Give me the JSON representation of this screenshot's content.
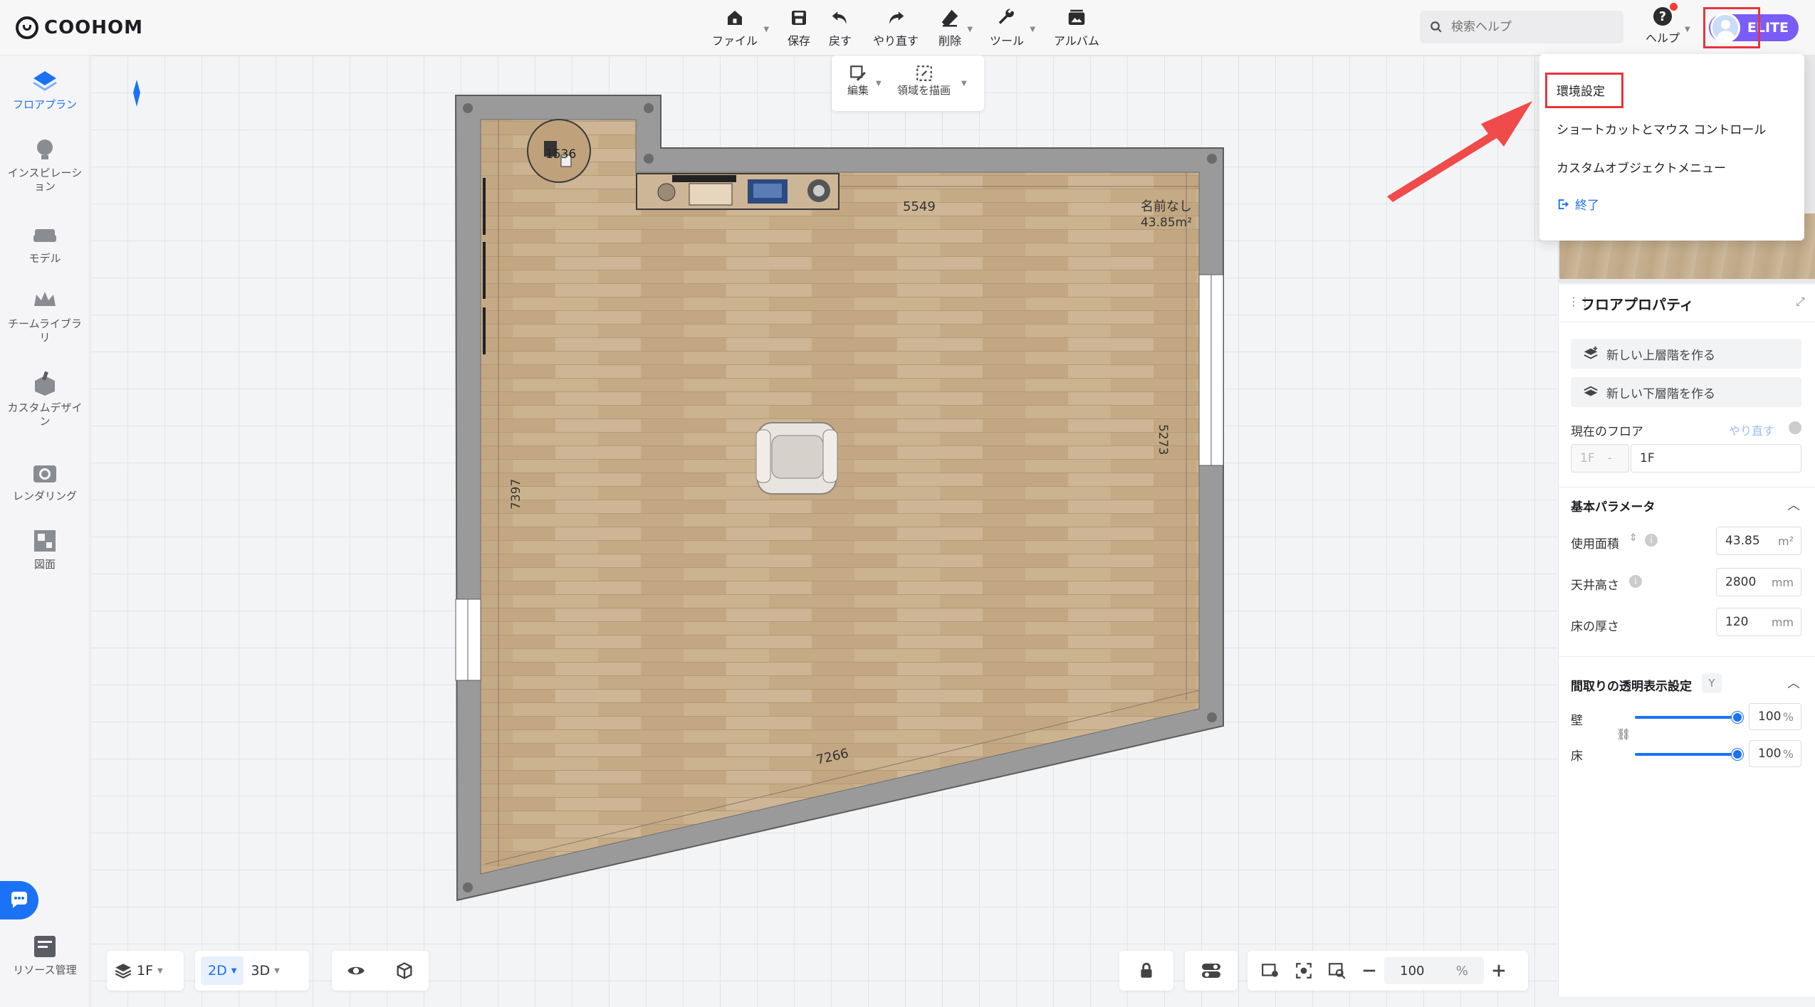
{
  "app": {
    "logo_text": "COOHOM"
  },
  "toolbar": {
    "file": "ファイル",
    "save": "保存",
    "undo": "戻す",
    "redo": "やり直す",
    "delete": "削除",
    "tools": "ツール",
    "album": "アルバム"
  },
  "subtoolbar": {
    "edit": "編集",
    "draw_region": "領域を描画"
  },
  "search": {
    "placeholder": "検索ヘルプ"
  },
  "help": {
    "label": "ヘルプ",
    "icon": "?"
  },
  "user": {
    "badge": "ELITE"
  },
  "user_menu": {
    "items": [
      "環境設定",
      "ショートカットとマウス コントロール",
      "カスタムオブジェクトメニュー"
    ],
    "exit": "終了"
  },
  "sidebar": {
    "items": [
      {
        "label": "フロアプラン",
        "icon": "floorplan-icon",
        "active": true
      },
      {
        "label": "インスピレーション",
        "icon": "lightbulb-icon"
      },
      {
        "label": "モデル",
        "icon": "sofa-icon"
      },
      {
        "label": "チームライブラリ",
        "icon": "crown-icon"
      },
      {
        "label": "カスタムデザイン",
        "icon": "custom-design-icon"
      },
      {
        "label": "レンダリング",
        "icon": "camera-icon"
      },
      {
        "label": "図面",
        "icon": "blueprint-icon"
      }
    ],
    "resource": "リソース管理"
  },
  "floorplan": {
    "room_name": "名前なし",
    "room_area": "43.85m²",
    "dimensions": {
      "top": "5549",
      "right": "5273",
      "left": "7397",
      "bottom": "7266",
      "round": "1536"
    }
  },
  "bottom_toolbar": {
    "floor": "1F",
    "view_2d": "2D",
    "view_3d": "3D",
    "zoom_value": "100",
    "zoom_unit": "%"
  },
  "panel": {
    "title": "フロアプロパティ",
    "new_upper": "新しい上層階を作る",
    "new_lower": "新しい下層階を作る",
    "current_floor_label": "現在のフロア",
    "redo_link": "やり直す",
    "floor_prefix": "1F",
    "floor_name": "1F",
    "basic_params": "基本パラメータ",
    "usable_area_label": "使用面積",
    "usable_area_value": "43.85",
    "usable_area_unit": "m²",
    "ceiling_label": "天井高さ",
    "ceiling_value": "2800",
    "ceiling_unit": "mm",
    "floor_thickness_label": "床の厚さ",
    "floor_thickness_value": "120",
    "floor_thickness_unit": "mm",
    "transparency_title": "間取りの透明表示設定",
    "transparency_key": "Y",
    "wall_label": "壁",
    "wall_value": "100",
    "wall_unit": "%",
    "wall_level": 1.0,
    "floor_label": "床",
    "floor_value": "100",
    "floor_unit": "%",
    "floor_level": 1.0
  },
  "colors": {
    "accent": "#1b72f6",
    "highlight": "#e9343a",
    "elite": "#7b5cf7"
  }
}
